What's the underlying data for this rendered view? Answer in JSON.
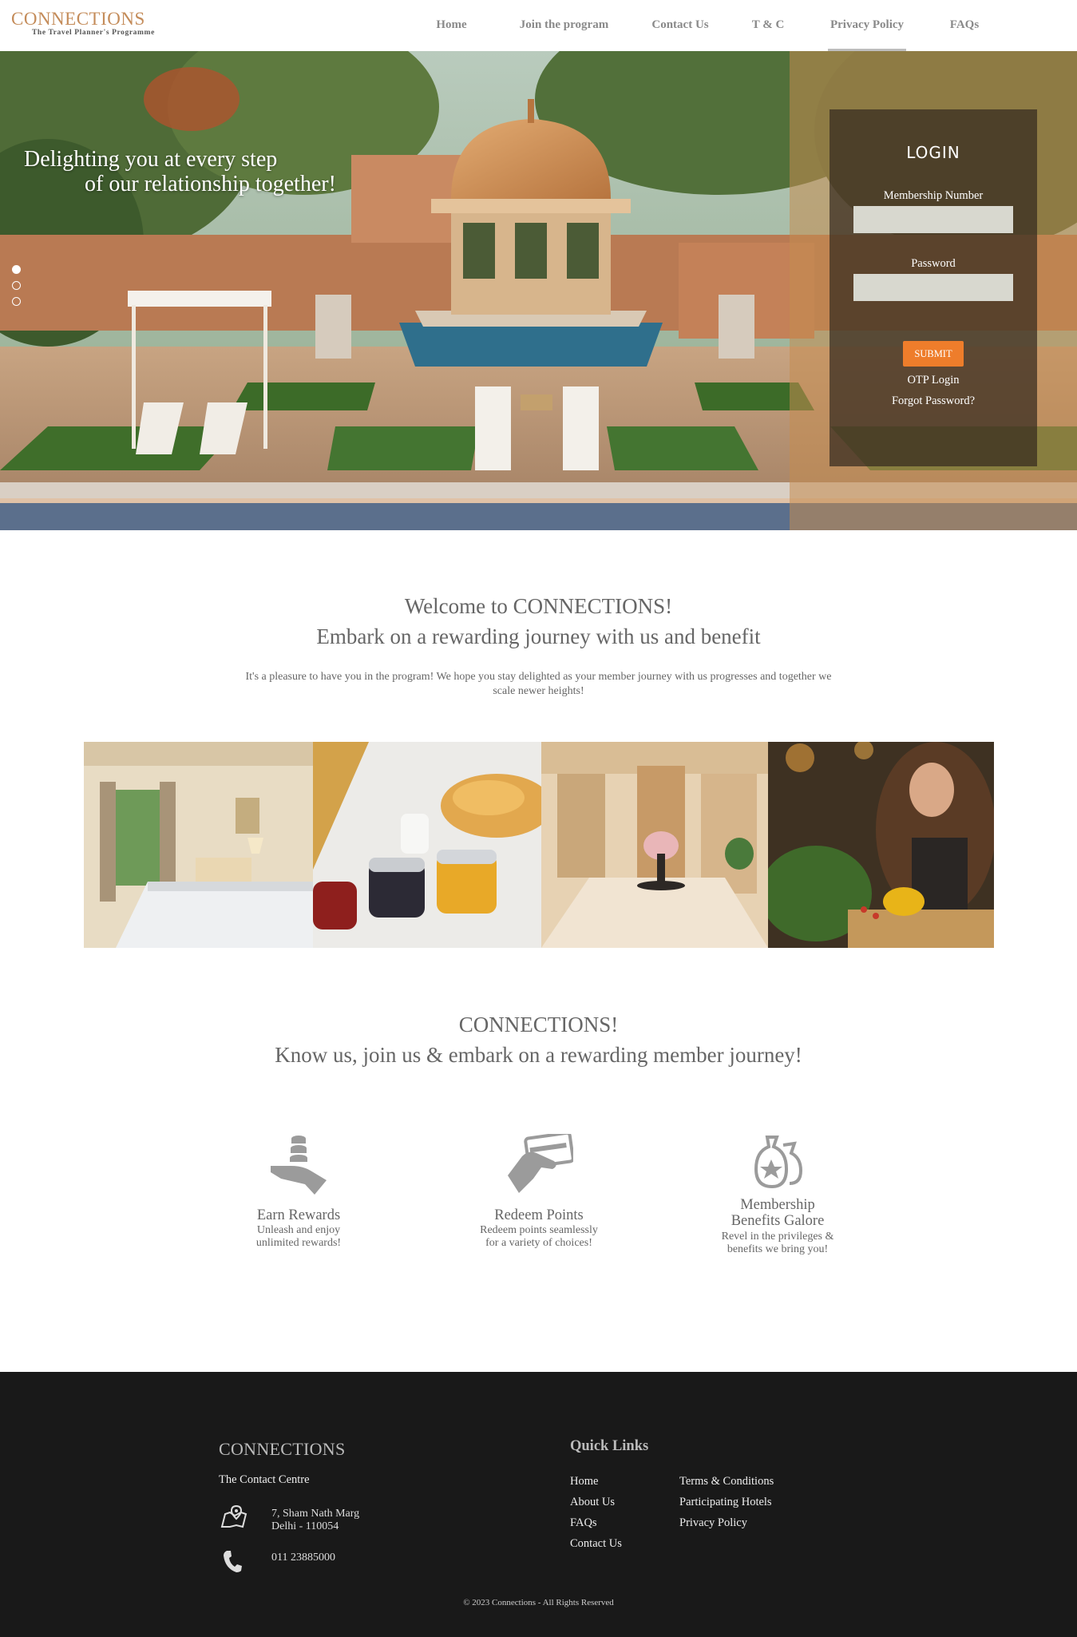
{
  "header": {
    "logo_main": "CONNECTIONS",
    "logo_sub": "The Travel Planner's Programme",
    "nav": [
      "Home",
      "Join the program",
      "Contact Us",
      "T & C",
      "Privacy Policy",
      "FAQs"
    ],
    "active_nav": "Privacy Policy"
  },
  "hero": {
    "tagline_line1": "Delighting you at every step",
    "tagline_line2": "of our relationship together!",
    "slides_total": 3,
    "slide_active": 1
  },
  "login": {
    "title": "LOGIN",
    "membership_label": "Membership Number",
    "membership_value": "",
    "password_label": "Password",
    "password_value": "",
    "submit_label": "SUBMIT",
    "otp_label": "OTP Login",
    "forgot_label": "Forgot Password?"
  },
  "welcome": {
    "title1": "Welcome to CONNECTIONS!",
    "title2": "Embark on a rewarding journey with us and benefit",
    "text": "It's a pleasure to have you in the program! We hope you stay delighted as your member journey with us progresses and together we scale newer heights!"
  },
  "about": {
    "title1": "CONNECTIONS!",
    "title2": "Know us, join us & embark on a rewarding member journey!",
    "features": [
      {
        "icon": "earn-rewards-icon",
        "title1": "Earn Rewards",
        "title2": "",
        "desc1": "Unleash and enjoy",
        "desc2": "unlimited rewards!"
      },
      {
        "icon": "redeem-points-icon",
        "title1": "Redeem Points",
        "title2": "",
        "desc1": "Redeem points seamlessly",
        "desc2": "for a variety of choices!"
      },
      {
        "icon": "membership-benefits-icon",
        "title1": "Membership",
        "title2": "Benefits Galore",
        "desc1": "Revel in the privileges &",
        "desc2": "benefits we bring you!"
      }
    ]
  },
  "footer": {
    "brand": "CONNECTIONS",
    "contact_centre": "The Contact Centre",
    "address_line1": "7, Sham Nath Marg",
    "address_line2": "Delhi - 110054",
    "phone": "011 23885000",
    "quick_links_title": "Quick Links",
    "links_col1": [
      "Home",
      "About Us",
      "FAQs",
      "Contact Us"
    ],
    "links_col2": [
      "Terms & Conditions",
      "Participating Hotels",
      "Privacy Policy"
    ],
    "copyright": "© 2023 Connections - All Rights Reserved"
  },
  "colors": {
    "brand_gold": "#c48c5a",
    "submit_orange": "#ee7d2b",
    "footer_bg": "#191919"
  }
}
